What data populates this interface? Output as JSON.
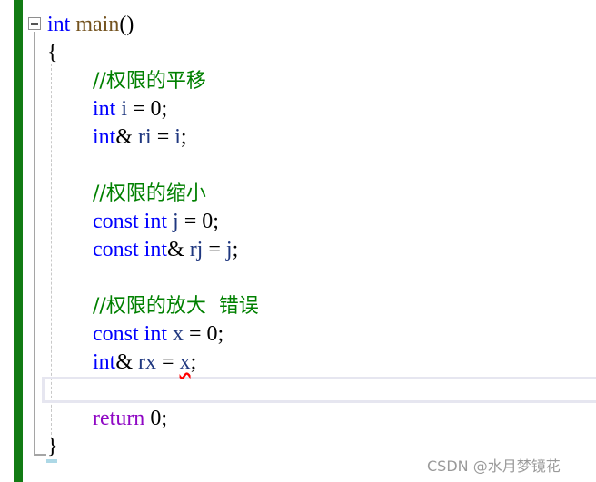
{
  "editor": {
    "lines": [
      {
        "tokens": [
          {
            "t": "int",
            "c": "kw"
          },
          {
            "t": " ",
            "c": ""
          },
          {
            "t": "main",
            "c": "fn"
          },
          {
            "t": "()",
            "c": ""
          }
        ]
      },
      {
        "tokens": [
          {
            "t": "{",
            "c": ""
          }
        ]
      },
      {
        "tokens": [
          {
            "t": "//权限的平移",
            "c": "cm"
          }
        ]
      },
      {
        "tokens": [
          {
            "t": "int",
            "c": "kw"
          },
          {
            "t": " ",
            "c": ""
          },
          {
            "t": "i",
            "c": "var"
          },
          {
            "t": " = 0;",
            "c": ""
          }
        ]
      },
      {
        "tokens": [
          {
            "t": "int",
            "c": "kw"
          },
          {
            "t": "& ",
            "c": ""
          },
          {
            "t": "ri",
            "c": "var"
          },
          {
            "t": " = ",
            "c": ""
          },
          {
            "t": "i",
            "c": "var"
          },
          {
            "t": ";",
            "c": ""
          }
        ]
      },
      {
        "tokens": []
      },
      {
        "tokens": [
          {
            "t": "//权限的缩小",
            "c": "cm"
          }
        ]
      },
      {
        "tokens": [
          {
            "t": "const",
            "c": "kw"
          },
          {
            "t": " ",
            "c": ""
          },
          {
            "t": "int",
            "c": "kw"
          },
          {
            "t": " ",
            "c": ""
          },
          {
            "t": "j",
            "c": "var"
          },
          {
            "t": " = 0;",
            "c": ""
          }
        ]
      },
      {
        "tokens": [
          {
            "t": "const",
            "c": "kw"
          },
          {
            "t": " ",
            "c": ""
          },
          {
            "t": "int",
            "c": "kw"
          },
          {
            "t": "& ",
            "c": ""
          },
          {
            "t": "rj",
            "c": "var"
          },
          {
            "t": " = ",
            "c": ""
          },
          {
            "t": "j",
            "c": "var"
          },
          {
            "t": ";",
            "c": ""
          }
        ]
      },
      {
        "tokens": []
      },
      {
        "tokens": [
          {
            "t": "//权限的放大  错误",
            "c": "cm"
          }
        ]
      },
      {
        "tokens": [
          {
            "t": "const",
            "c": "kw"
          },
          {
            "t": " ",
            "c": ""
          },
          {
            "t": "int",
            "c": "kw"
          },
          {
            "t": " ",
            "c": ""
          },
          {
            "t": "x",
            "c": "var"
          },
          {
            "t": " = 0;",
            "c": ""
          }
        ]
      },
      {
        "tokens": [
          {
            "t": "int",
            "c": "kw"
          },
          {
            "t": "& ",
            "c": ""
          },
          {
            "t": "rx",
            "c": "var"
          },
          {
            "t": " = ",
            "c": ""
          },
          {
            "t": "x",
            "c": "var err"
          },
          {
            "t": ";",
            "c": ""
          }
        ]
      },
      {
        "tokens": []
      },
      {
        "tokens": [
          {
            "t": "return",
            "c": "ctl"
          },
          {
            "t": " 0;",
            "c": ""
          }
        ]
      },
      {
        "tokens": [
          {
            "t": "}",
            "c": ""
          }
        ]
      }
    ],
    "indented": [
      false,
      false,
      true,
      true,
      true,
      true,
      true,
      true,
      true,
      true,
      true,
      true,
      true,
      true,
      true,
      false
    ],
    "current_line": 14
  },
  "watermark": "CSDN @水月梦镜花"
}
